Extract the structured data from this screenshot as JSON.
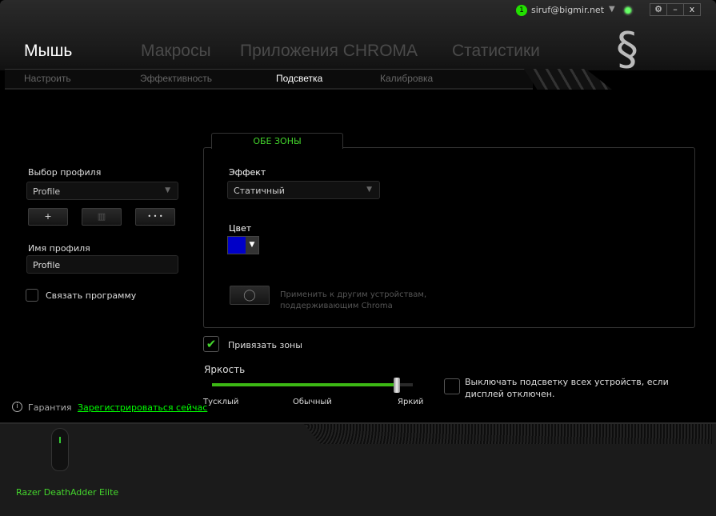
{
  "titlebar": {
    "notification_count": "1",
    "account": "siruf@bigmir.net",
    "settings_icon": "gear-icon",
    "minimize_label": "–",
    "close_label": "x"
  },
  "main_tabs": [
    {
      "label": "Мышь",
      "active": true
    },
    {
      "label": "Макросы"
    },
    {
      "label": "Приложения CHROMA"
    },
    {
      "label": "Статистики"
    }
  ],
  "sub_tabs": [
    {
      "label": "Настроить"
    },
    {
      "label": "Эффективность"
    },
    {
      "label": "Подсветка",
      "active": true
    },
    {
      "label": "Калибровка"
    }
  ],
  "profile": {
    "select_label": "Выбор профиля",
    "selected": "Profile",
    "add_label": "+",
    "delete_icon": "trash-icon",
    "more_label": "• • •",
    "name_label": "Имя профиля",
    "name_value": "Profile",
    "link_program_label": "Связать программу",
    "link_program_checked": false
  },
  "lighting": {
    "zone_tab": "ОБЕ ЗОНЫ",
    "effect_label": "Эффект",
    "effect_value": "Статичный",
    "color_label": "Цвет",
    "color_value": "#0000c8",
    "apply_text": "Применить к другим устройствам, поддерживающим Chroma",
    "apply_enabled": false,
    "bind_zones_label": "Привязать зоны",
    "bind_zones_checked": true,
    "brightness_label": "Яркость",
    "brightness_percent": 92,
    "brightness_ticks": [
      "Тусклый",
      "Обычный",
      "Яркий"
    ],
    "display_off_label": "Выключать подсветку всех устройств, если дисплей отключен.",
    "display_off_checked": false
  },
  "warranty": {
    "label": "Гарантия",
    "register_link": "Зарегистрироваться сейчас"
  },
  "device": {
    "name": "Razer DeathAdder Elite"
  },
  "colors": {
    "accent": "#44d62c",
    "link": "#00ff00"
  }
}
